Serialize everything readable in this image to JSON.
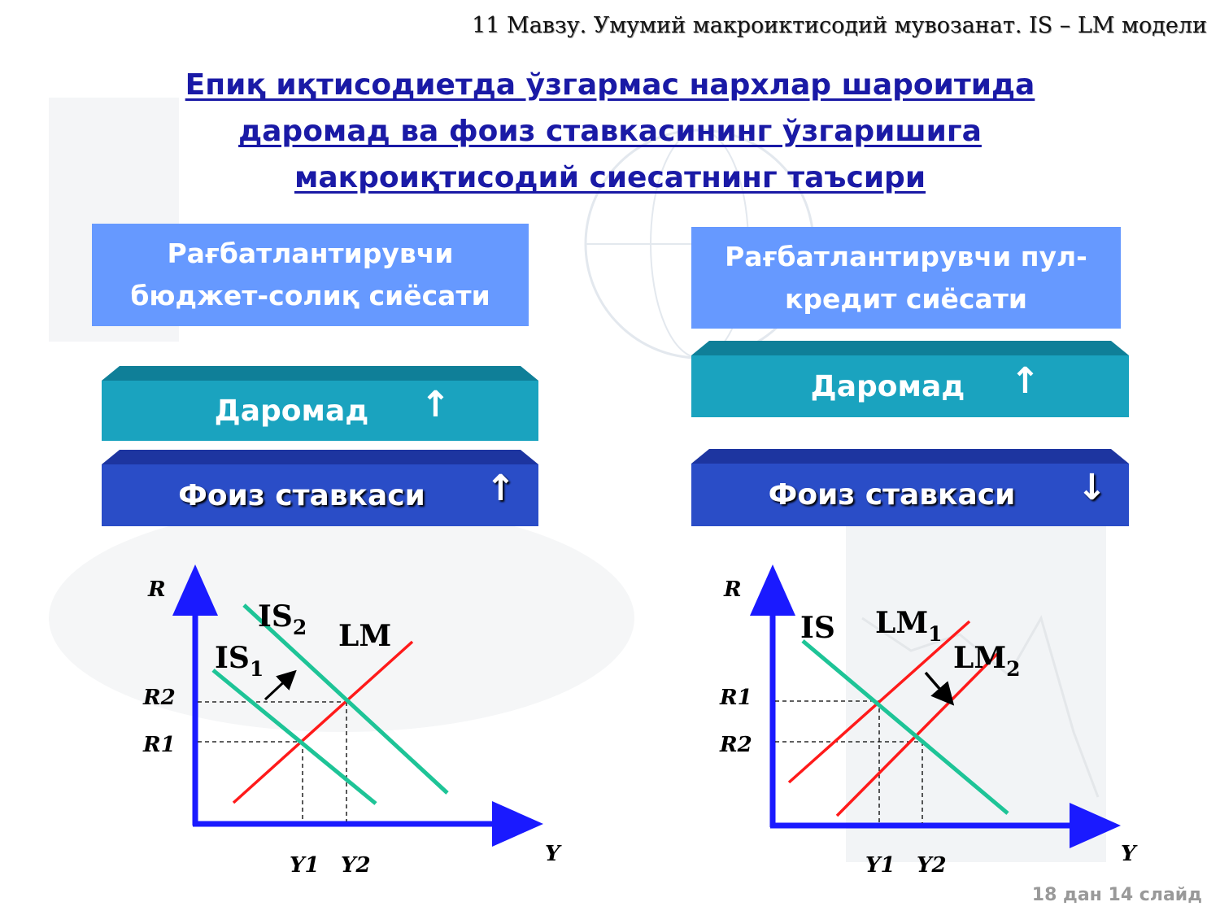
{
  "header": "11  Мавзу. Умумий  макроиктисодий  мувозанат.  IS  –  LM  модели",
  "title_lines": [
    "Епиқ иқтисодиетда ўзгармас нархлар шароитида",
    "даромад ва фоиз ставкасининг ўзгаришига",
    "макроиқтисодий сиесатнинг таъсири"
  ],
  "left": {
    "policy_lines": [
      "Рағбатлантирувчи",
      "бюджет-солиқ сиёсати"
    ],
    "income_label": "Даромад",
    "income_arrow": "up",
    "rate_label": "Фоиз ставкаси",
    "rate_arrow": "up"
  },
  "right": {
    "policy_lines": [
      "Рағбатлантирувчи пул-",
      "кредит сиёсати"
    ],
    "income_label": "Даромад",
    "income_arrow": "up",
    "rate_label": "Фоиз ставкаси",
    "rate_arrow": "down"
  },
  "charts": [
    {
      "axis_y_label": "R",
      "axis_x_label": "Y",
      "r_ticks": [
        "R2",
        "R1"
      ],
      "y_ticks": [
        "Y1",
        "Y2"
      ],
      "curves": [
        {
          "name": "IS",
          "sub": "2"
        },
        {
          "name": "IS",
          "sub": "1"
        },
        {
          "name": "LM",
          "sub": ""
        }
      ],
      "colors": {
        "is": "#1ec497",
        "lm": "#ff1a1a",
        "axis": "#1a1aff"
      }
    },
    {
      "axis_y_label": "R",
      "axis_x_label": "Y",
      "r_ticks": [
        "R1",
        "R2"
      ],
      "y_ticks": [
        "Y1",
        "Y2"
      ],
      "curves": [
        {
          "name": "IS",
          "sub": ""
        },
        {
          "name": "LM",
          "sub": "1"
        },
        {
          "name": "LM",
          "sub": "2"
        }
      ],
      "colors": {
        "is": "#1ec497",
        "lm": "#ff1a1a",
        "axis": "#1a1aff"
      }
    }
  ],
  "footer": "18 дан 14 слайд"
}
